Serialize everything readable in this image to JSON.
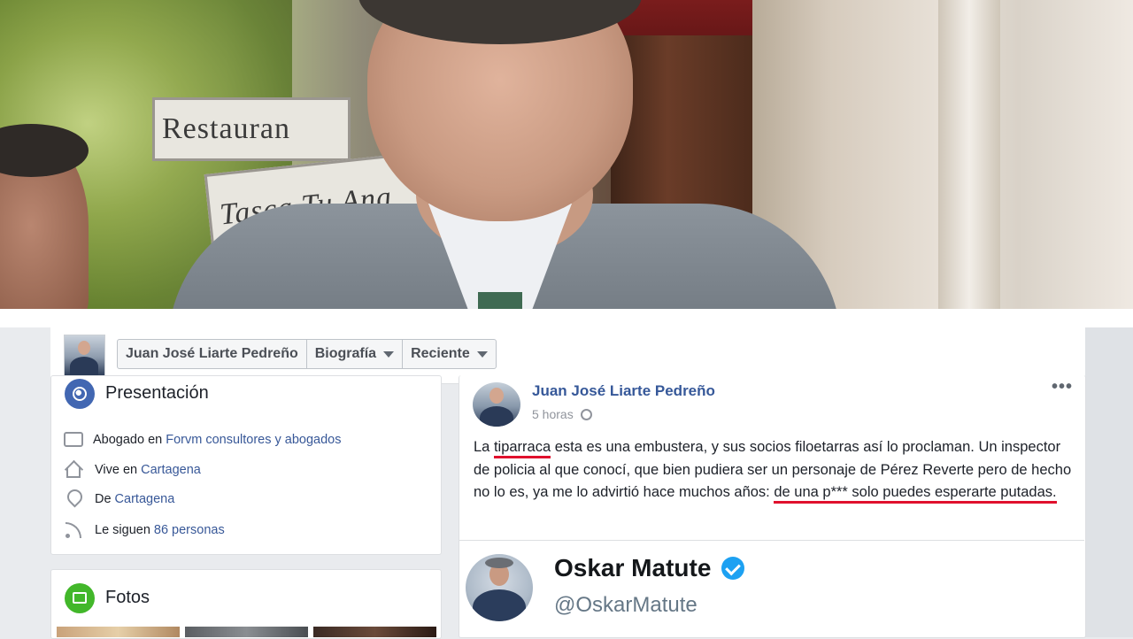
{
  "photo": {
    "sign_1": "Restauran",
    "sign_2": "Tasca Tu Ana"
  },
  "profile_header": {
    "breadcrumbs": [
      "Juan José Liarte Pedreño",
      "Biografía",
      "Reciente"
    ]
  },
  "intro": {
    "title": "Presentación",
    "rows": [
      {
        "icon": "briefcase-icon",
        "prefix": "Abogado en",
        "link": "Forvm consultores y abogados"
      },
      {
        "icon": "house-icon",
        "prefix": "Vive en",
        "link": "Cartagena"
      },
      {
        "icon": "location-pin-icon",
        "prefix": "De",
        "link": "Cartagena"
      },
      {
        "icon": "followers-icon",
        "prefix": "Le siguen",
        "link": "86 personas"
      }
    ]
  },
  "photos": {
    "title": "Fotos"
  },
  "post": {
    "author": "Juan José Liarte Pedreño",
    "time": "5 horas",
    "menu": "•••",
    "text_part1": "La ",
    "text_highlight1": "tiparraca",
    "text_part2": " esta es una embustera, y sus socios filoetarras así lo proclaman. Un inspector de policia al que conocí, que bien pudiera ser un personaje de Pérez Reverte pero de hecho no lo es, ya me lo advirtió hace muchos años: ",
    "text_highlight2": "de una p*** solo puedes esperarte putadas.",
    "highlight_color": "#e0102d"
  },
  "embedded_tweet": {
    "name": "Oskar Matute",
    "handle": "@OskarMatute",
    "verified_color": "#1da1f2"
  },
  "colors": {
    "link": "#385898",
    "facebook_blue": "#4267b2",
    "photos_green": "#42b72a"
  }
}
